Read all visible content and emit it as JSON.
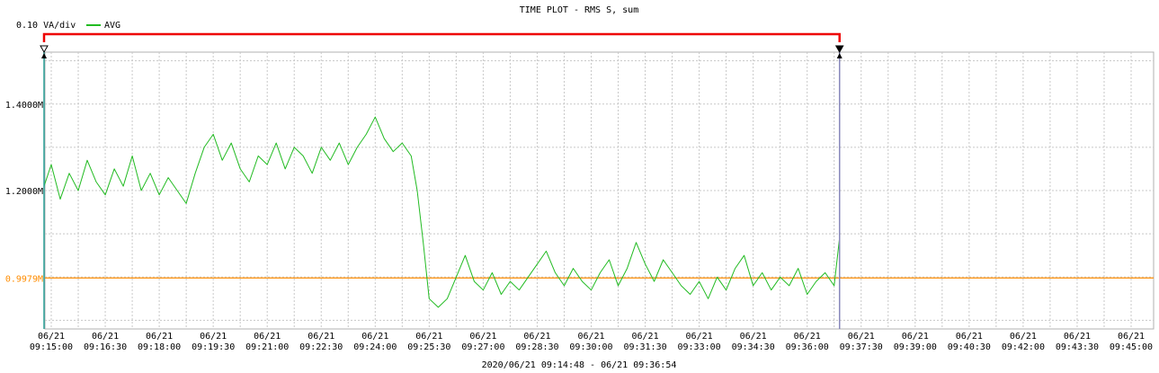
{
  "chart_data": {
    "type": "line",
    "title": "TIME PLOT - RMS  S, sum",
    "scale_label": "0.10 VA/div",
    "range_label": "2020/06/21 09:14:48 - 06/21 09:36:54",
    "legend": [
      {
        "name": "AVG",
        "color": "#22bb22"
      }
    ],
    "reference": {
      "label": "0.9979M",
      "value": 0.9979,
      "color": "#ff8c00"
    },
    "y_ticks": [
      {
        "label": "1.4000M",
        "value": 1.4
      },
      {
        "label": "1.2000M",
        "value": 1.2
      }
    ],
    "ylim": [
      0.88,
      1.52
    ],
    "x_ticks": [
      {
        "date": "06/21",
        "time": "09:15:00"
      },
      {
        "date": "06/21",
        "time": "09:16:30"
      },
      {
        "date": "06/21",
        "time": "09:18:00"
      },
      {
        "date": "06/21",
        "time": "09:19:30"
      },
      {
        "date": "06/21",
        "time": "09:21:00"
      },
      {
        "date": "06/21",
        "time": "09:22:30"
      },
      {
        "date": "06/21",
        "time": "09:24:00"
      },
      {
        "date": "06/21",
        "time": "09:25:30"
      },
      {
        "date": "06/21",
        "time": "09:27:00"
      },
      {
        "date": "06/21",
        "time": "09:28:30"
      },
      {
        "date": "06/21",
        "time": "09:30:00"
      },
      {
        "date": "06/21",
        "time": "09:31:30"
      },
      {
        "date": "06/21",
        "time": "09:33:00"
      },
      {
        "date": "06/21",
        "time": "09:34:30"
      },
      {
        "date": "06/21",
        "time": "09:36:00"
      },
      {
        "date": "06/21",
        "time": "09:37:30"
      },
      {
        "date": "06/21",
        "time": "09:39:00"
      },
      {
        "date": "06/21",
        "time": "09:40:30"
      },
      {
        "date": "06/21",
        "time": "09:42:00"
      },
      {
        "date": "06/21",
        "time": "09:43:30"
      },
      {
        "date": "06/21",
        "time": "09:45:00"
      }
    ],
    "cursor_start": "09:14:48",
    "cursor_end": "09:36:54",
    "series": [
      {
        "name": "AVG",
        "color": "#22bb22",
        "points": [
          [
            "09:14:48",
            1.21
          ],
          [
            "09:15:00",
            1.26
          ],
          [
            "09:15:15",
            1.18
          ],
          [
            "09:15:30",
            1.24
          ],
          [
            "09:15:45",
            1.2
          ],
          [
            "09:16:00",
            1.27
          ],
          [
            "09:16:15",
            1.22
          ],
          [
            "09:16:30",
            1.19
          ],
          [
            "09:16:45",
            1.25
          ],
          [
            "09:17:00",
            1.21
          ],
          [
            "09:17:15",
            1.28
          ],
          [
            "09:17:30",
            1.2
          ],
          [
            "09:17:45",
            1.24
          ],
          [
            "09:18:00",
            1.19
          ],
          [
            "09:18:15",
            1.23
          ],
          [
            "09:18:30",
            1.2
          ],
          [
            "09:18:45",
            1.17
          ],
          [
            "09:19:00",
            1.24
          ],
          [
            "09:19:15",
            1.3
          ],
          [
            "09:19:30",
            1.33
          ],
          [
            "09:19:45",
            1.27
          ],
          [
            "09:20:00",
            1.31
          ],
          [
            "09:20:15",
            1.25
          ],
          [
            "09:20:30",
            1.22
          ],
          [
            "09:20:45",
            1.28
          ],
          [
            "09:21:00",
            1.26
          ],
          [
            "09:21:15",
            1.31
          ],
          [
            "09:21:30",
            1.25
          ],
          [
            "09:21:45",
            1.3
          ],
          [
            "09:22:00",
            1.28
          ],
          [
            "09:22:15",
            1.24
          ],
          [
            "09:22:30",
            1.3
          ],
          [
            "09:22:45",
            1.27
          ],
          [
            "09:23:00",
            1.31
          ],
          [
            "09:23:15",
            1.26
          ],
          [
            "09:23:30",
            1.3
          ],
          [
            "09:23:45",
            1.33
          ],
          [
            "09:24:00",
            1.37
          ],
          [
            "09:24:15",
            1.32
          ],
          [
            "09:24:30",
            1.29
          ],
          [
            "09:24:45",
            1.31
          ],
          [
            "09:25:00",
            1.28
          ],
          [
            "09:25:10",
            1.2
          ],
          [
            "09:25:20",
            1.08
          ],
          [
            "09:25:30",
            0.95
          ],
          [
            "09:25:45",
            0.93
          ],
          [
            "09:26:00",
            0.95
          ],
          [
            "09:26:15",
            1.0
          ],
          [
            "09:26:30",
            1.05
          ],
          [
            "09:26:45",
            0.99
          ],
          [
            "09:27:00",
            0.97
          ],
          [
            "09:27:15",
            1.01
          ],
          [
            "09:27:30",
            0.96
          ],
          [
            "09:27:45",
            0.99
          ],
          [
            "09:28:00",
            0.97
          ],
          [
            "09:28:15",
            1.0
          ],
          [
            "09:28:30",
            1.03
          ],
          [
            "09:28:45",
            1.06
          ],
          [
            "09:29:00",
            1.01
          ],
          [
            "09:29:15",
            0.98
          ],
          [
            "09:29:30",
            1.02
          ],
          [
            "09:29:45",
            0.99
          ],
          [
            "09:30:00",
            0.97
          ],
          [
            "09:30:15",
            1.01
          ],
          [
            "09:30:30",
            1.04
          ],
          [
            "09:30:45",
            0.98
          ],
          [
            "09:31:00",
            1.02
          ],
          [
            "09:31:15",
            1.08
          ],
          [
            "09:31:30",
            1.03
          ],
          [
            "09:31:45",
            0.99
          ],
          [
            "09:32:00",
            1.04
          ],
          [
            "09:32:15",
            1.01
          ],
          [
            "09:32:30",
            0.98
          ],
          [
            "09:32:45",
            0.96
          ],
          [
            "09:33:00",
            0.99
          ],
          [
            "09:33:15",
            0.95
          ],
          [
            "09:33:30",
            1.0
          ],
          [
            "09:33:45",
            0.97
          ],
          [
            "09:34:00",
            1.02
          ],
          [
            "09:34:15",
            1.05
          ],
          [
            "09:34:30",
            0.98
          ],
          [
            "09:34:45",
            1.01
          ],
          [
            "09:35:00",
            0.97
          ],
          [
            "09:35:15",
            1.0
          ],
          [
            "09:35:30",
            0.98
          ],
          [
            "09:35:45",
            1.02
          ],
          [
            "09:36:00",
            0.96
          ],
          [
            "09:36:15",
            0.99
          ],
          [
            "09:36:30",
            1.01
          ],
          [
            "09:36:45",
            0.98
          ],
          [
            "09:36:54",
            1.09
          ]
        ]
      }
    ]
  }
}
